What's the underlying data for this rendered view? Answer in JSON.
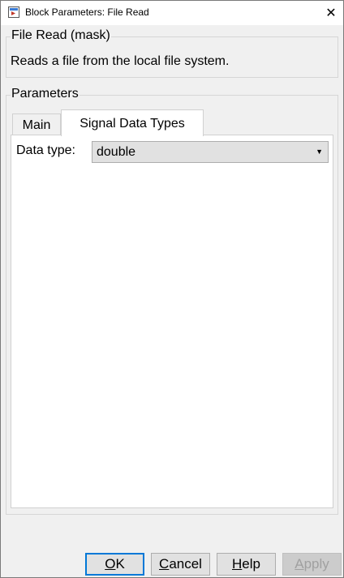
{
  "window": {
    "title": "Block Parameters: File Read",
    "close_glyph": "✕"
  },
  "mask_group": {
    "title": "File Read (mask)",
    "description": "Reads a file from the local file system."
  },
  "parameters_group": {
    "title": "Parameters",
    "tabs": [
      {
        "label": "Main",
        "active": false
      },
      {
        "label": "Signal Data Types",
        "active": true
      }
    ],
    "data_type": {
      "label": "Data type:",
      "value": "double"
    }
  },
  "buttons": {
    "ok": {
      "mnemonic": "O",
      "rest": "K"
    },
    "cancel": {
      "mnemonic": "C",
      "rest": "ancel"
    },
    "help": {
      "mnemonic": "H",
      "rest": "elp"
    },
    "apply": {
      "mnemonic": "A",
      "rest": "pply",
      "disabled": true
    }
  },
  "icons": {
    "title_icon": "simulink-block-icon",
    "dropdown": "chevron-down-icon"
  }
}
